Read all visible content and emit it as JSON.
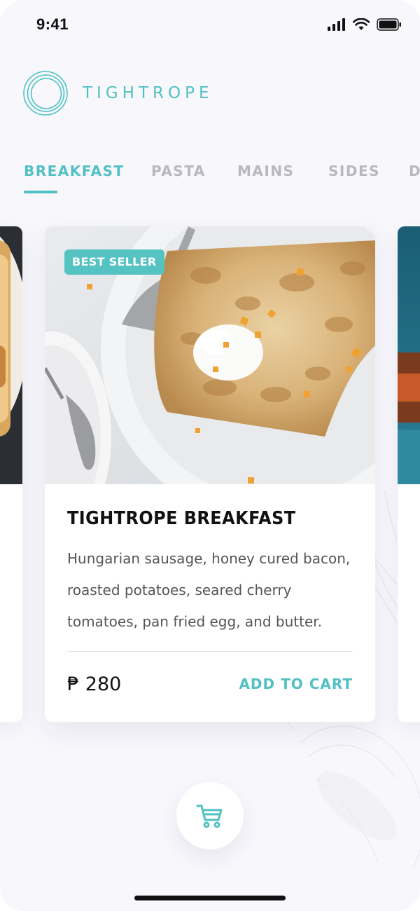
{
  "status_bar": {
    "time": "9:41"
  },
  "brand": {
    "name": "TIGHTROPE",
    "accent_color": "#52c0c4"
  },
  "tabs": [
    {
      "label": "BREAKFAST",
      "active": true
    },
    {
      "label": "PASTA",
      "active": false
    },
    {
      "label": "MAINS",
      "active": false
    },
    {
      "label": "SIDES",
      "active": false
    },
    {
      "label": "D",
      "active": false
    }
  ],
  "card": {
    "badge": "BEST SELLER",
    "title": "TIGHTROPE BREAKFAST",
    "description_lines": [
      "Hungarian sausage, honey cured bacon,",
      "roasted potatoes, seared cherry",
      "tomatoes, pan fried  egg, and butter."
    ],
    "price": "₱ 280",
    "add_to_cart": "ADD TO CART",
    "photo_icon": "crepe-photo"
  },
  "cart_button": {
    "icon": "cart-icon"
  }
}
